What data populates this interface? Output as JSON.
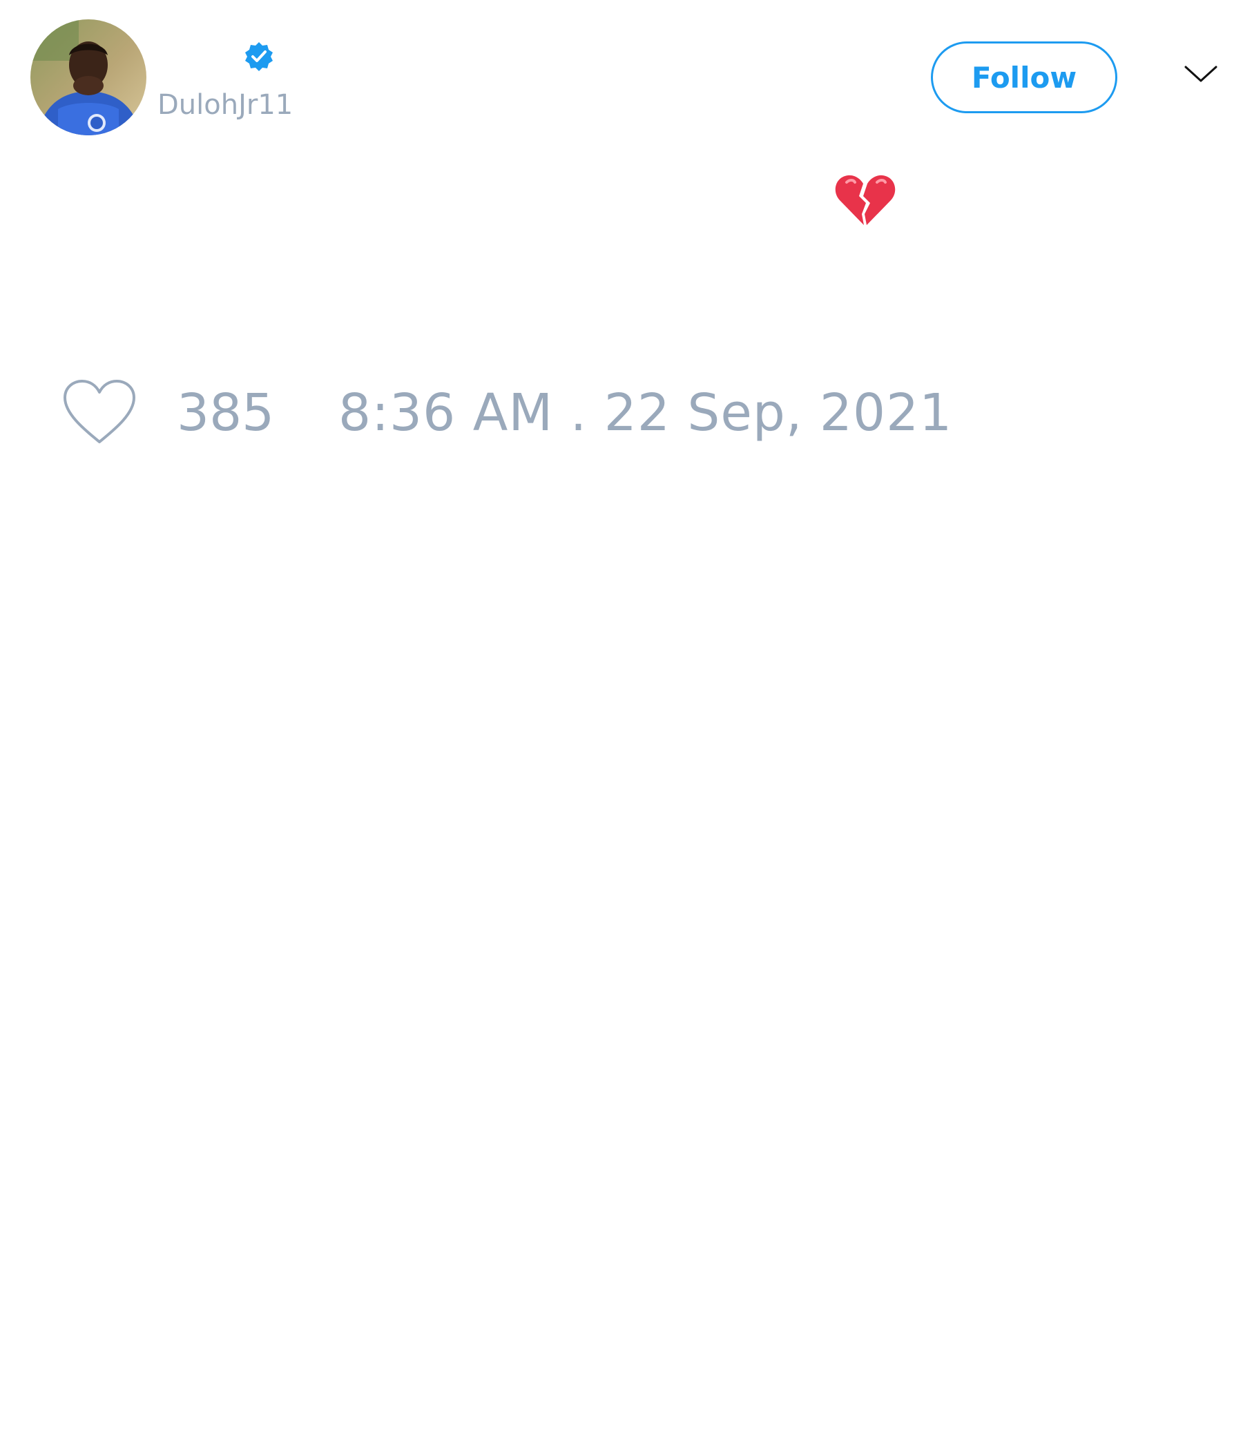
{
  "tweet": {
    "author": {
      "handle": "DulohJr11",
      "verified": true,
      "avatar": "avatar-photo"
    },
    "follow_label": "Follow",
    "menu_icon": "chevron-down-icon",
    "text_emoji": "broken-heart-icon",
    "likes": "385",
    "timestamp": "8:36 AM . 22 Sep, 2021"
  },
  "colors": {
    "accent": "#1d9bf0",
    "muted_text": "#9aa9bb",
    "background": "#ffffff",
    "broken_heart": "#e8334a"
  }
}
